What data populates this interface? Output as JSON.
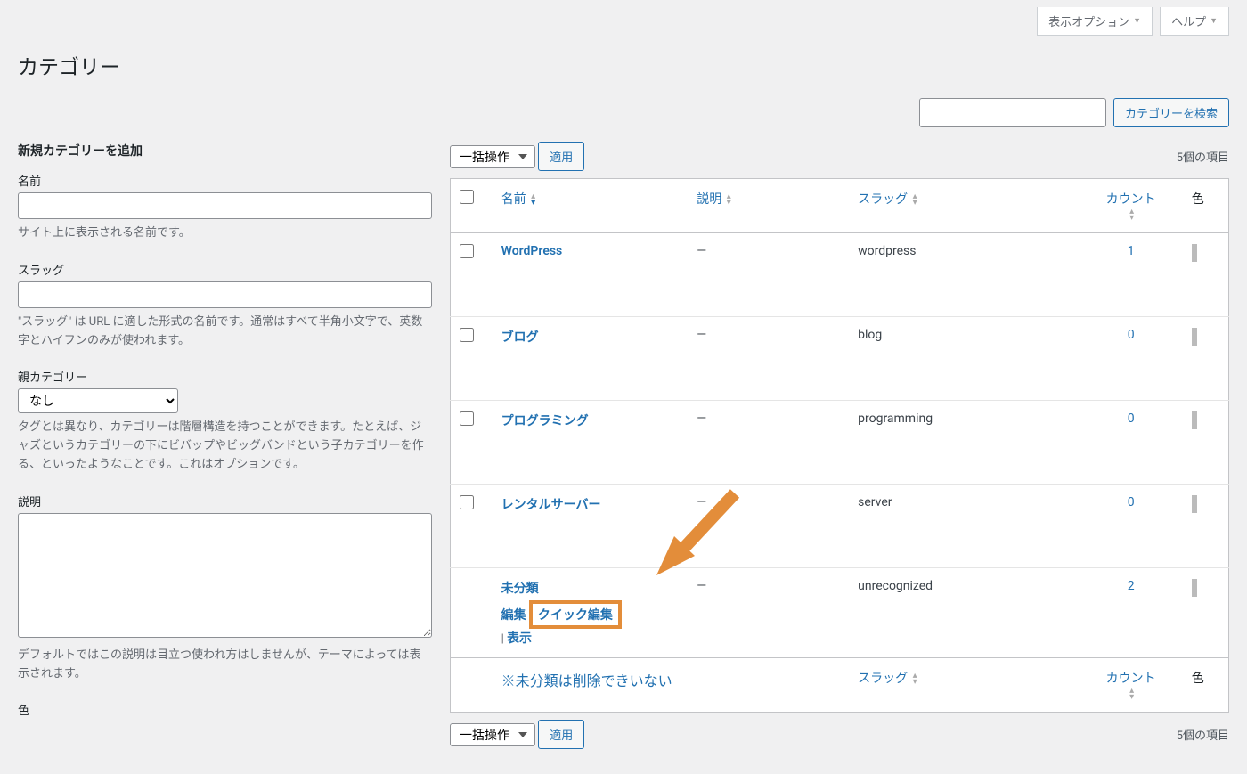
{
  "top": {
    "display_options": "表示オプション",
    "help": "ヘルプ"
  },
  "page_title": "カテゴリー",
  "search": {
    "button": "カテゴリーを検索"
  },
  "form": {
    "heading": "新規カテゴリーを追加",
    "name_label": "名前",
    "name_desc": "サイト上に表示される名前です。",
    "slug_label": "スラッグ",
    "slug_desc": "\"スラッグ\" は URL に適した形式の名前です。通常はすべて半角小文字で、英数字とハイフンのみが使われます。",
    "parent_label": "親カテゴリー",
    "parent_option": "なし",
    "parent_desc": "タグとは異なり、カテゴリーは階層構造を持つことができます。たとえば、ジャズというカテゴリーの下にビバップやビッグバンドという子カテゴリーを作る、といったようなことです。これはオプションです。",
    "desc_label": "説明",
    "desc_desc": "デフォルトではこの説明は目立つ使われ方はしませんが、テーマによっては表示されます。",
    "color_label": "色"
  },
  "bulk": {
    "select": "一括操作",
    "apply": "適用",
    "items_count": "5個の項目"
  },
  "columns": {
    "name": "名前",
    "description": "説明",
    "slug": "スラッグ",
    "count": "カウント",
    "color": "色"
  },
  "rows": [
    {
      "name": "WordPress",
      "desc": "—",
      "slug": "wordpress",
      "count": "1"
    },
    {
      "name": "ブログ",
      "desc": "—",
      "slug": "blog",
      "count": "0"
    },
    {
      "name": "プログラミング",
      "desc": "—",
      "slug": "programming",
      "count": "0"
    },
    {
      "name": "レンタルサーバー",
      "desc": "—",
      "slug": "server",
      "count": "0"
    },
    {
      "name": "未分類",
      "desc": "—",
      "slug": "unrecognized",
      "count": "2",
      "show_actions": true
    }
  ],
  "actions": {
    "edit": "編集",
    "quick_edit": "クイック編集",
    "view": "表示"
  },
  "footer_note": "※未分類は削除できいない"
}
